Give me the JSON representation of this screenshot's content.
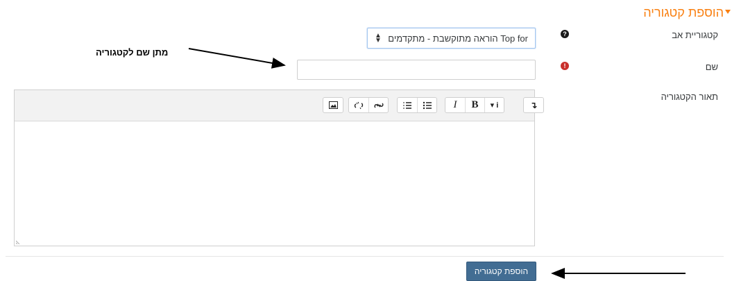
{
  "section": {
    "title": "הוספת קטגוריה"
  },
  "fields": {
    "parent_label": "קטגוריית אב",
    "parent_value": "Top for הוראה מתוקשבת - מתקדמים",
    "name_label": "שם",
    "name_value": "",
    "description_label": "תאור הקטגוריה"
  },
  "annotations": {
    "name_hint": "מתן שם לקטגוריה"
  },
  "editor": {
    "toolbar_groups": [
      [
        "collapse-icon"
      ],
      [
        "paragraph-style-icon",
        "bold-icon",
        "italic-icon"
      ],
      [
        "unordered-list-icon",
        "ordered-list-icon"
      ],
      [
        "link-icon",
        "unlink-icon"
      ],
      [
        "image-icon"
      ]
    ]
  },
  "buttons": {
    "submit_label": "הוספת קטגוריה"
  },
  "colors": {
    "accent": "#f98012",
    "primary_button": "#426d93",
    "required": "#c9302c"
  }
}
